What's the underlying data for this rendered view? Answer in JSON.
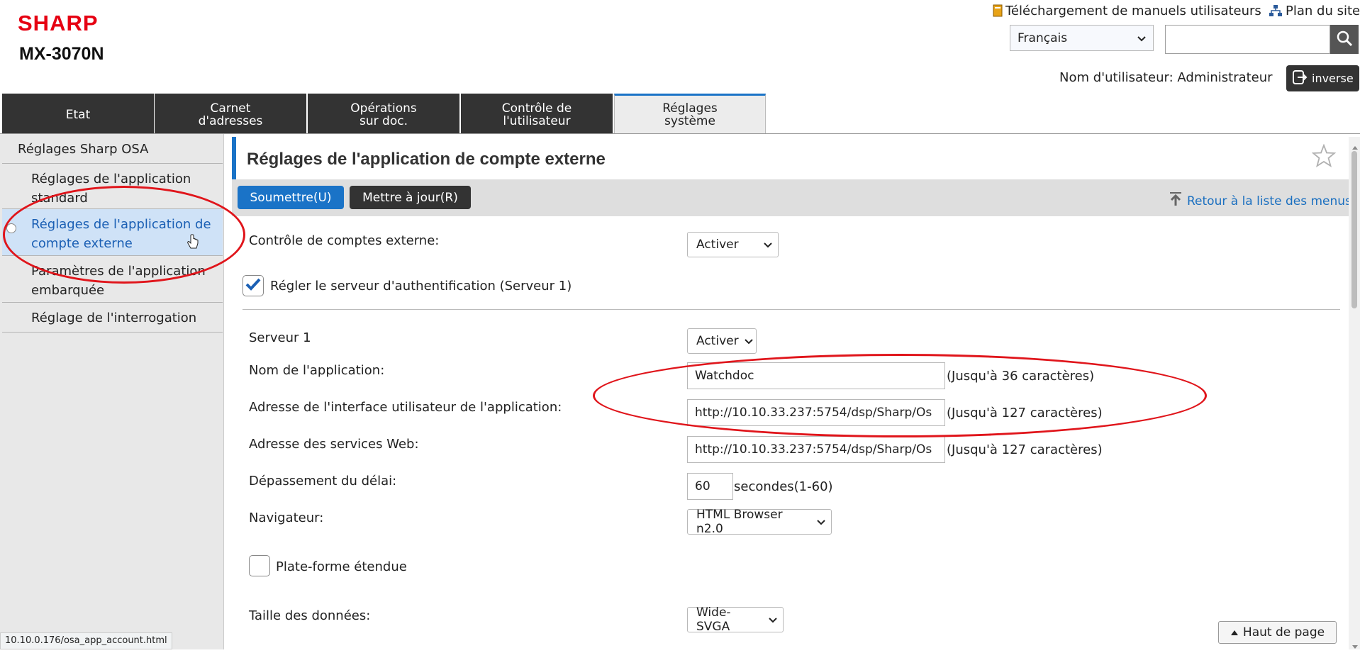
{
  "header": {
    "brand": "SHARP",
    "model": "MX-3070N",
    "manual_link": "Téléchargement de manuels utilisateurs",
    "sitemap_link": "Plan du site",
    "language_selected": "Français",
    "search_placeholder": "",
    "user_label": "Nom d'utilisateur: Administrateur",
    "logout_label": "inverse"
  },
  "tabs": [
    {
      "label": "Etat"
    },
    {
      "label": "Carnet\nd'adresses"
    },
    {
      "label": "Opérations\nsur doc."
    },
    {
      "label": "Contrôle de\nl'utilisateur"
    },
    {
      "label": "Réglages\nsystème"
    }
  ],
  "sidebar": {
    "header": "Réglages Sharp OSA",
    "items": [
      {
        "label": "Réglages de l'application standard"
      },
      {
        "label": "Réglages de l'application de compte externe"
      },
      {
        "label": "Paramètres de l'application embarquée"
      },
      {
        "label": "Réglage de l'interrogation"
      }
    ]
  },
  "main": {
    "title": "Réglages de l'application de compte externe",
    "submit_label": "Soumettre(U)",
    "update_label": "Mettre à jour(R)",
    "back_label": "Retour à la liste des menus",
    "external_control_label": "Contrôle de comptes externe:",
    "external_control_value": "Activer",
    "auth_server_label": "Régler le serveur d'authentification (Serveur 1)",
    "server1_label": "Serveur 1",
    "server1_value": "Activer",
    "app_name_label": "Nom de l'application:",
    "app_name_value": "Watchdoc",
    "app_name_hint": "(Jusqu'à 36 caractères)",
    "ui_address_label": "Adresse de l'interface utilisateur de l'application:",
    "ui_address_value": "http://10.10.33.237:5754/dsp/Sharp/Os",
    "ui_address_hint": "(Jusqu'à 127 caractères)",
    "ws_address_label": "Adresse des services Web:",
    "ws_address_value": "http://10.10.33.237:5754/dsp/Sharp/Os",
    "ws_address_hint": "(Jusqu'à 127 caractères)",
    "timeout_label": "Dépassement du délai:",
    "timeout_value": "60",
    "timeout_unit": "secondes(1-60)",
    "browser_label": "Navigateur:",
    "browser_value": "HTML Browser n2.0",
    "extended_platform_label": "Plate-forme étendue",
    "data_size_label": "Taille des données:",
    "data_size_value": "Wide-SVGA",
    "top_button": "Haut de page"
  },
  "statusbar": {
    "url": "10.10.0.176/osa_app_account.html"
  },
  "colors": {
    "accent": "#1a73c7",
    "brand": "#e60012",
    "annotation": "#e0151b",
    "tab_bg": "#333333"
  }
}
